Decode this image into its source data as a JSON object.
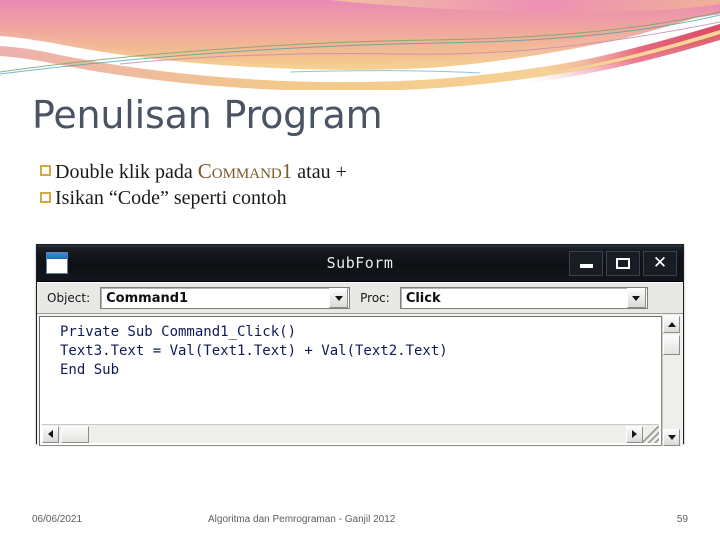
{
  "slide": {
    "title": "Penulisan Program",
    "theme": {
      "title_color": "#4a5464",
      "bullet_marker_color": "#d4a843",
      "accent_pink": "#eb8fb4",
      "accent_orange": "#f2c98a",
      "accent_red": "#e0566e",
      "highlight_color": "#7a5a28"
    }
  },
  "bullets": [
    {
      "marker": "hollow-square-bullet",
      "parts": [
        {
          "text": "Double klik pada ",
          "style": "normal"
        },
        {
          "text": "Command1",
          "style": "highlight"
        },
        {
          "text": " atau +",
          "style": "normal"
        }
      ],
      "plain": "Double klik pada Command1 atau +"
    },
    {
      "marker": "hollow-square-bullet",
      "parts": [
        {
          "text": "Isikan “Code” seperti contoh",
          "style": "normal"
        }
      ],
      "plain": "Isikan “Code” seperti contoh"
    }
  ],
  "code_window": {
    "titlebar": {
      "icon": "form-window-icon",
      "title": "SubForm",
      "buttons": [
        {
          "name": "minimize",
          "glyph": "–"
        },
        {
          "name": "maximize",
          "glyph": "□"
        },
        {
          "name": "close",
          "glyph": "✕"
        }
      ]
    },
    "toolbar": {
      "object_label": "Object:",
      "object_value": "Command1",
      "proc_label": "Proc:",
      "proc_value": "Click"
    },
    "code": "Private Sub Command1_Click()\nText3.Text = Val(Text1.Text) + Val(Text2.Text)\nEnd Sub",
    "scrollbars": {
      "vertical": {
        "up": "▲",
        "down": "▼"
      },
      "horizontal": {
        "left": "◀",
        "right": "▶"
      },
      "resize_grip": "resize-grip"
    }
  },
  "footer": {
    "date": "06/06/2021",
    "center": "Algoritma dan Pemrograman - Ganjil 2012",
    "page": "59"
  }
}
